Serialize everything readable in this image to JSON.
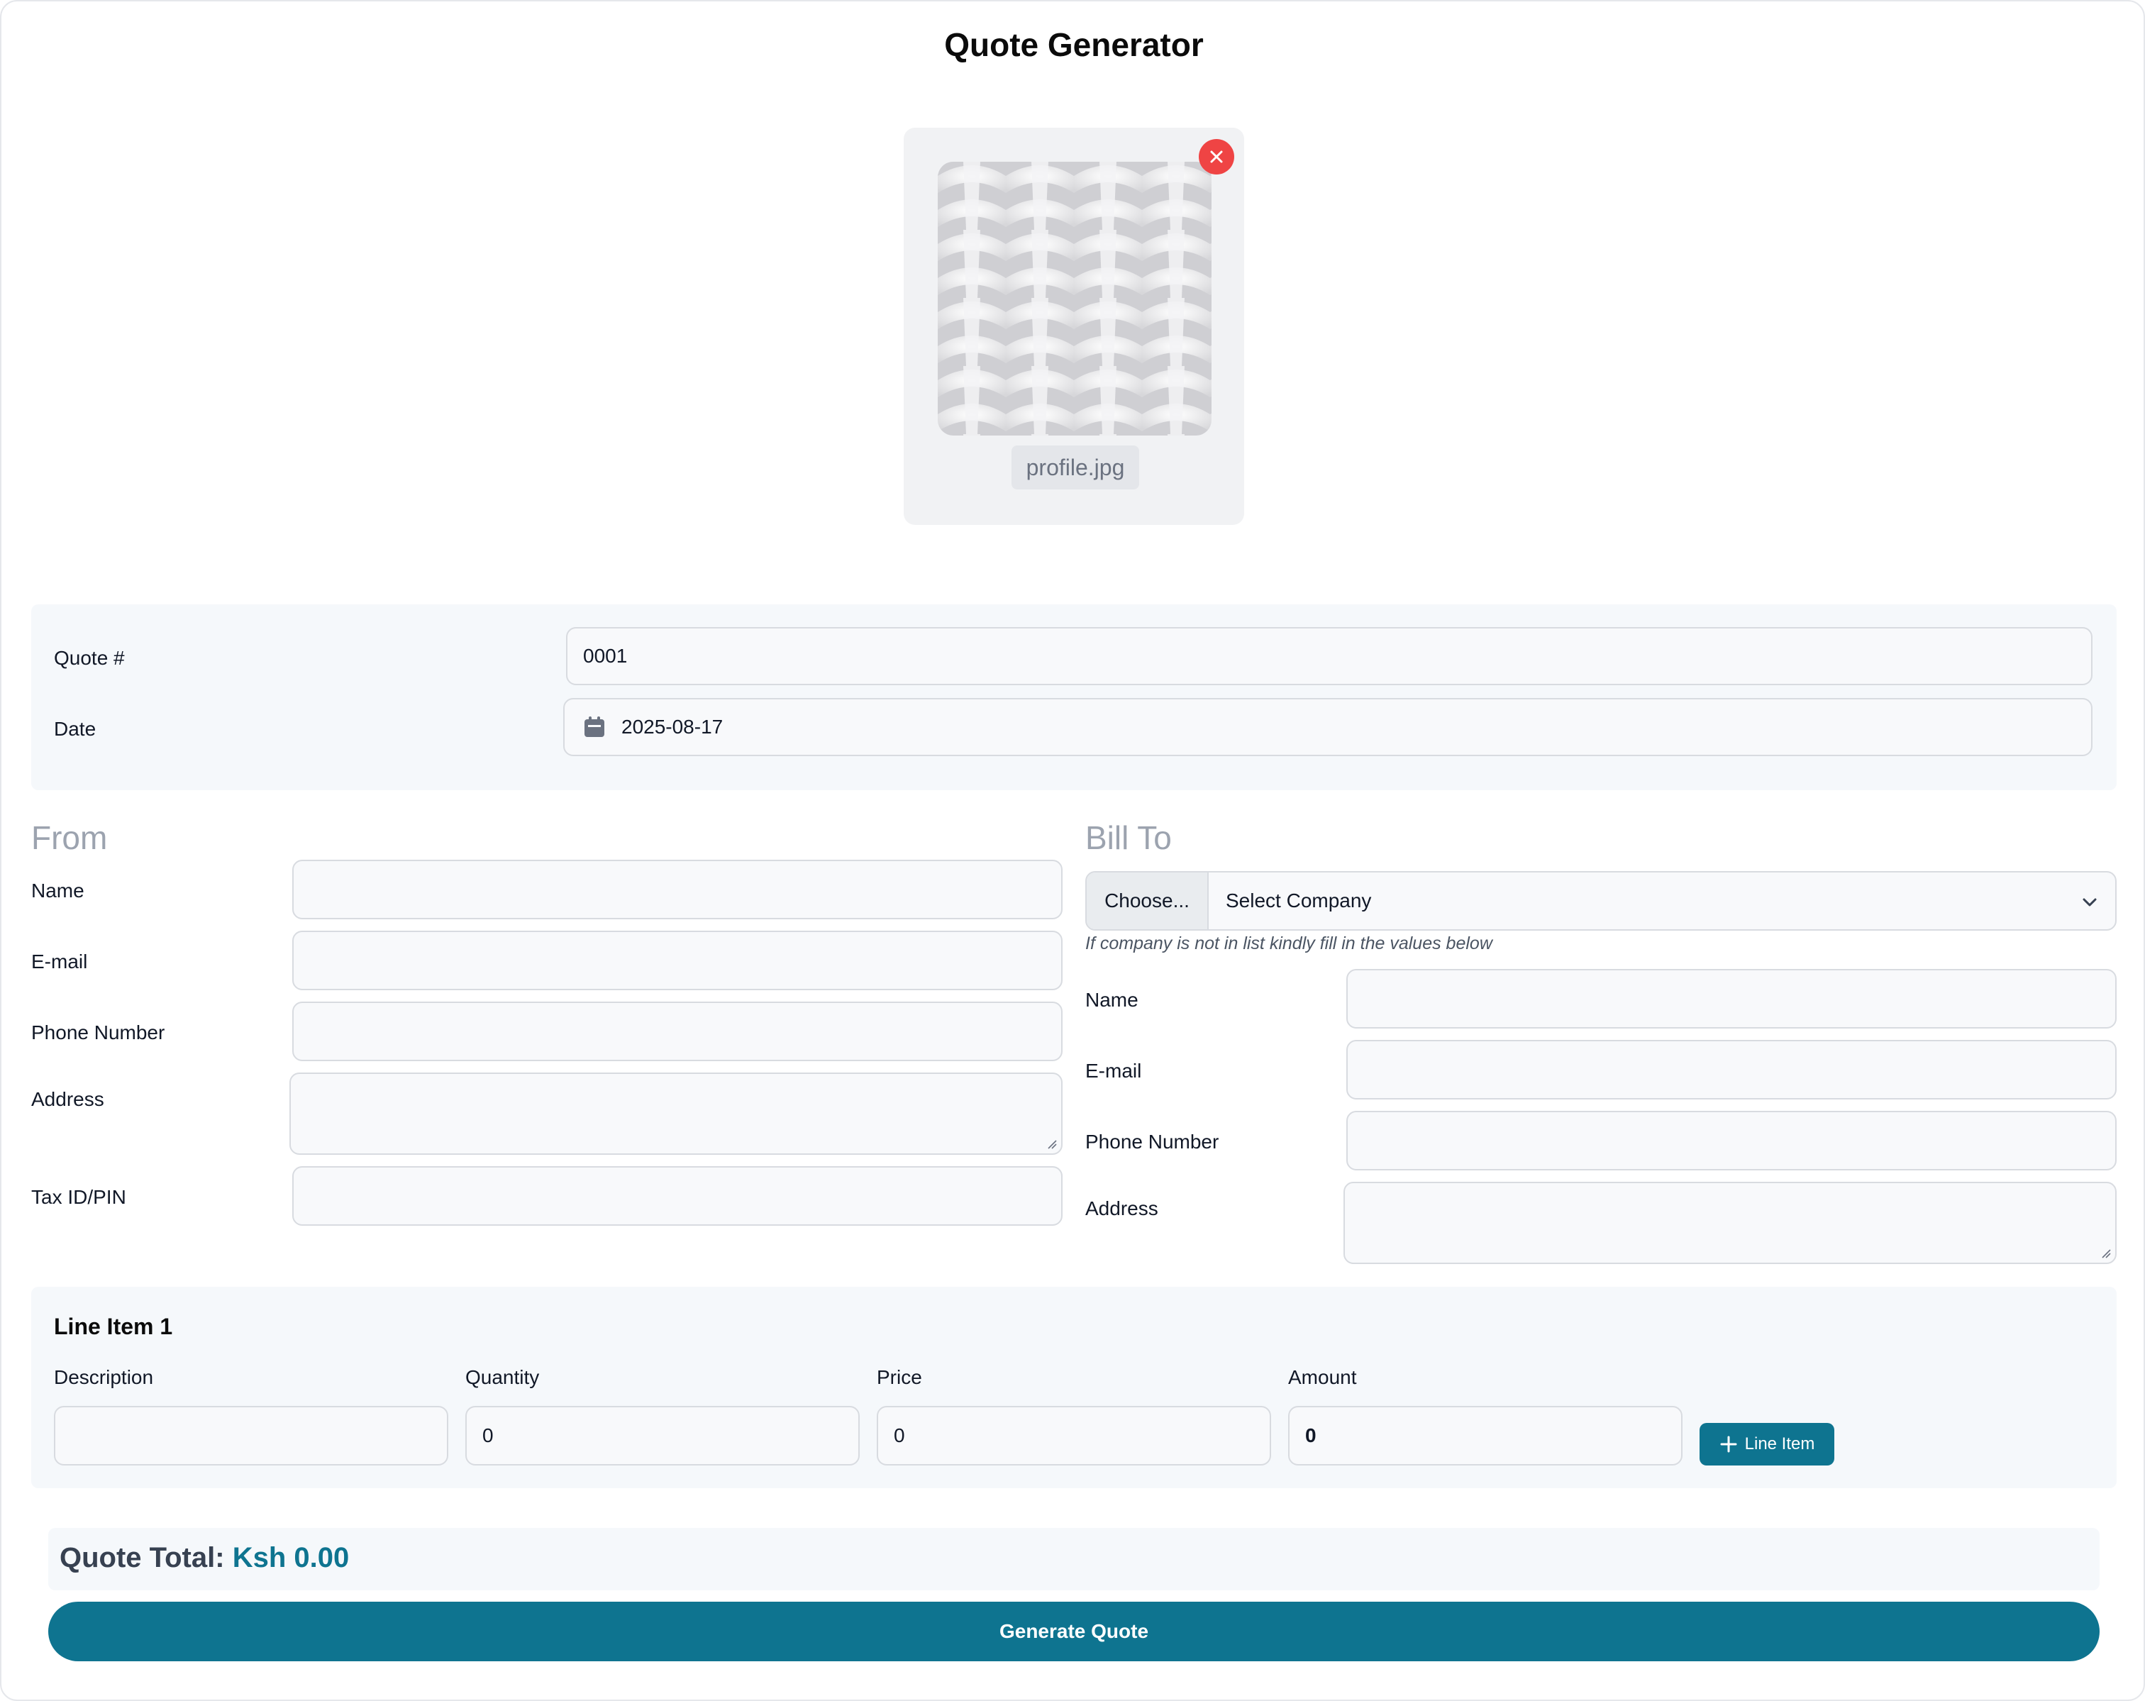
{
  "page_title": "Quote Generator",
  "upload": {
    "file_name": "profile.jpg",
    "remove_icon": "close-icon"
  },
  "meta": {
    "quote_label": "Quote #",
    "quote_value": "0001",
    "date_label": "Date",
    "date_value": "2025-08-17",
    "date_icon": "calendar-icon"
  },
  "from": {
    "heading": "From",
    "name_label": "Name",
    "email_label": "E-mail",
    "phone_label": "Phone Number",
    "address_label": "Address",
    "tax_label": "Tax ID/PIN"
  },
  "bill_to": {
    "heading": "Bill To",
    "choose_label": "Choose...",
    "select_value": "Select Company",
    "hint": "If company is not in list kindly fill in the values below",
    "name_label": "Name",
    "email_label": "E-mail",
    "phone_label": "Phone Number",
    "address_label": "Address"
  },
  "line_item": {
    "title": "Line Item 1",
    "description_label": "Description",
    "quantity_label": "Quantity",
    "price_label": "Price",
    "amount_label": "Amount",
    "description_value": "",
    "quantity_value": "0",
    "price_value": "0",
    "amount_value": "0",
    "add_button": "Line Item"
  },
  "total": {
    "label": "Quote Total:",
    "value": "Ksh 0.00"
  },
  "generate_button": "Generate Quote",
  "colors": {
    "accent": "#0e7490",
    "danger": "#ef4444",
    "panel": "#f5f8fb"
  }
}
